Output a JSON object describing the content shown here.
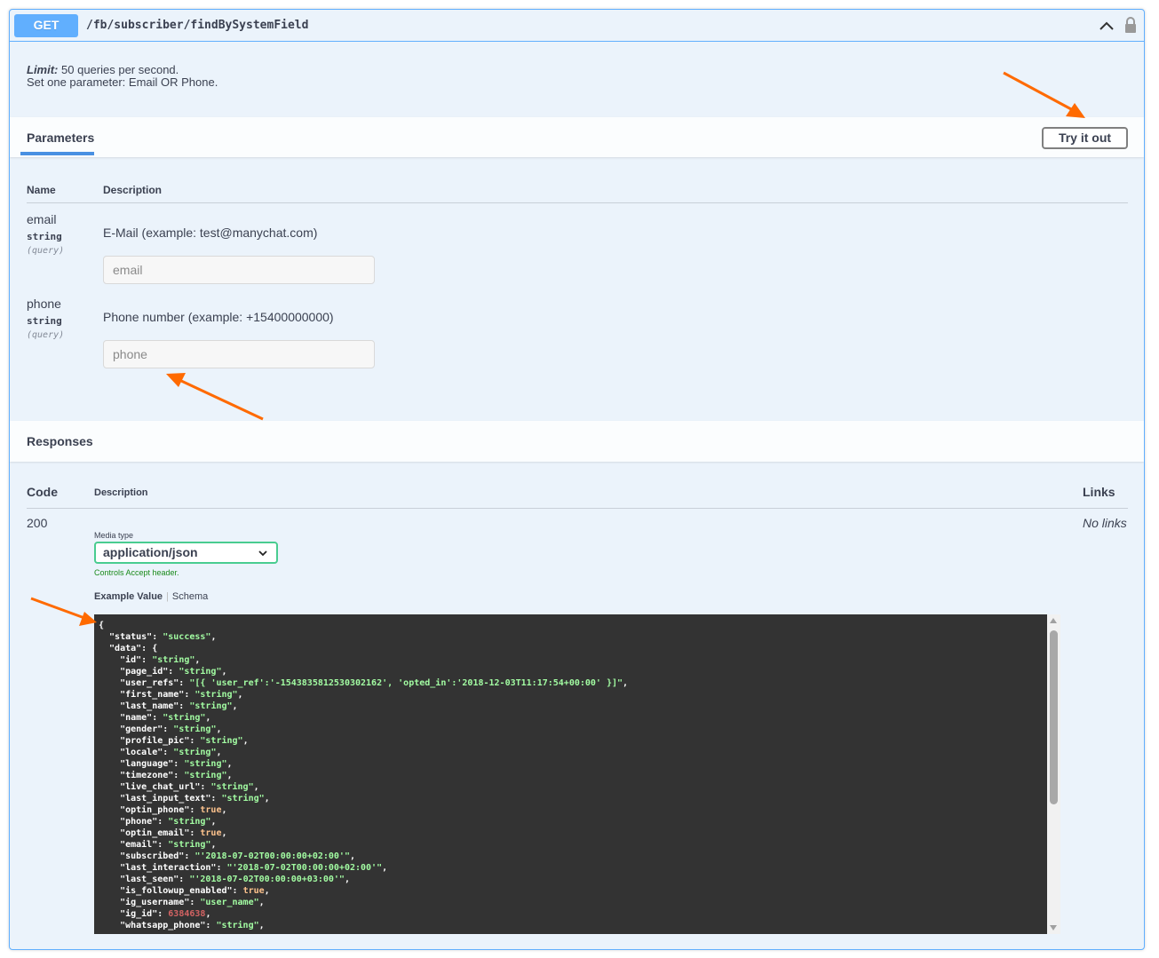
{
  "summary": {
    "method": "GET",
    "path": "/fb/subscriber/findBySystemField"
  },
  "description": {
    "limit_label": "Limit:",
    "limit_text": "50 queries per second.",
    "line2": "Set one parameter: Email OR Phone."
  },
  "parameters": {
    "section_title": "Parameters",
    "try_button": "Try it out",
    "col_name": "Name",
    "col_description": "Description",
    "items": [
      {
        "name": "email",
        "type": "string",
        "in": "(query)",
        "description": "E-Mail (example: test@manychat.com)",
        "placeholder": "email"
      },
      {
        "name": "phone",
        "type": "string",
        "in": "(query)",
        "description": "Phone number (example: +15400000000)",
        "placeholder": "phone"
      }
    ]
  },
  "responses": {
    "section_title": "Responses",
    "col_code": "Code",
    "col_description": "Description",
    "col_links": "Links",
    "code": "200",
    "no_links": "No links",
    "media_type_label": "Media type",
    "media_type_value": "application/json",
    "controls_note": "Controls Accept header.",
    "example_tab": "Example Value",
    "schema_tab": "Schema"
  },
  "example_json_lines": [
    [
      [
        "k",
        "{"
      ]
    ],
    [
      [
        "k",
        "  \"status\": "
      ],
      [
        "s",
        "\"success\""
      ],
      [
        "k",
        ","
      ]
    ],
    [
      [
        "k",
        "  \"data\": {"
      ]
    ],
    [
      [
        "k",
        "    \"id\": "
      ],
      [
        "s",
        "\"string\""
      ],
      [
        "k",
        ","
      ]
    ],
    [
      [
        "k",
        "    \"page_id\": "
      ],
      [
        "s",
        "\"string\""
      ],
      [
        "k",
        ","
      ]
    ],
    [
      [
        "k",
        "    \"user_refs\": "
      ],
      [
        "s",
        "\"[{ 'user_ref':'-1543835812530302162', 'opted_in':'2018-12-03T11:17:54+00:00' }]\""
      ],
      [
        "k",
        ","
      ]
    ],
    [
      [
        "k",
        "    \"first_name\": "
      ],
      [
        "s",
        "\"string\""
      ],
      [
        "k",
        ","
      ]
    ],
    [
      [
        "k",
        "    \"last_name\": "
      ],
      [
        "s",
        "\"string\""
      ],
      [
        "k",
        ","
      ]
    ],
    [
      [
        "k",
        "    \"name\": "
      ],
      [
        "s",
        "\"string\""
      ],
      [
        "k",
        ","
      ]
    ],
    [
      [
        "k",
        "    \"gender\": "
      ],
      [
        "s",
        "\"string\""
      ],
      [
        "k",
        ","
      ]
    ],
    [
      [
        "k",
        "    \"profile_pic\": "
      ],
      [
        "s",
        "\"string\""
      ],
      [
        "k",
        ","
      ]
    ],
    [
      [
        "k",
        "    \"locale\": "
      ],
      [
        "s",
        "\"string\""
      ],
      [
        "k",
        ","
      ]
    ],
    [
      [
        "k",
        "    \"language\": "
      ],
      [
        "s",
        "\"string\""
      ],
      [
        "k",
        ","
      ]
    ],
    [
      [
        "k",
        "    \"timezone\": "
      ],
      [
        "s",
        "\"string\""
      ],
      [
        "k",
        ","
      ]
    ],
    [
      [
        "k",
        "    \"live_chat_url\": "
      ],
      [
        "s",
        "\"string\""
      ],
      [
        "k",
        ","
      ]
    ],
    [
      [
        "k",
        "    \"last_input_text\": "
      ],
      [
        "s",
        "\"string\""
      ],
      [
        "k",
        ","
      ]
    ],
    [
      [
        "k",
        "    \"optin_phone\": "
      ],
      [
        "b",
        "true"
      ],
      [
        "k",
        ","
      ]
    ],
    [
      [
        "k",
        "    \"phone\": "
      ],
      [
        "s",
        "\"string\""
      ],
      [
        "k",
        ","
      ]
    ],
    [
      [
        "k",
        "    \"optin_email\": "
      ],
      [
        "b",
        "true"
      ],
      [
        "k",
        ","
      ]
    ],
    [
      [
        "k",
        "    \"email\": "
      ],
      [
        "s",
        "\"string\""
      ],
      [
        "k",
        ","
      ]
    ],
    [
      [
        "k",
        "    \"subscribed\": "
      ],
      [
        "s",
        "\"'2018-07-02T00:00:00+02:00'\""
      ],
      [
        "k",
        ","
      ]
    ],
    [
      [
        "k",
        "    \"last_interaction\": "
      ],
      [
        "s",
        "\"'2018-07-02T00:00:00+02:00'\""
      ],
      [
        "k",
        ","
      ]
    ],
    [
      [
        "k",
        "    \"last_seen\": "
      ],
      [
        "s",
        "\"'2018-07-02T00:00:00+03:00'\""
      ],
      [
        "k",
        ","
      ]
    ],
    [
      [
        "k",
        "    \"is_followup_enabled\": "
      ],
      [
        "b",
        "true"
      ],
      [
        "k",
        ","
      ]
    ],
    [
      [
        "k",
        "    \"ig_username\": "
      ],
      [
        "s",
        "\"user_name\""
      ],
      [
        "k",
        ","
      ]
    ],
    [
      [
        "k",
        "    \"ig_id\": "
      ],
      [
        "n",
        "6384638"
      ],
      [
        "k",
        ","
      ]
    ],
    [
      [
        "k",
        "    \"whatsapp_phone\": "
      ],
      [
        "s",
        "\"string\""
      ],
      [
        "k",
        ","
      ]
    ]
  ],
  "colors": {
    "get_blue": "#61affe",
    "accent_orange": "#ff6a00",
    "code_bg": "#333333",
    "string_green": "#a2fca2",
    "bool_orange": "#fcc28c",
    "number_red": "#d36363",
    "select_border": "#49cc90"
  }
}
